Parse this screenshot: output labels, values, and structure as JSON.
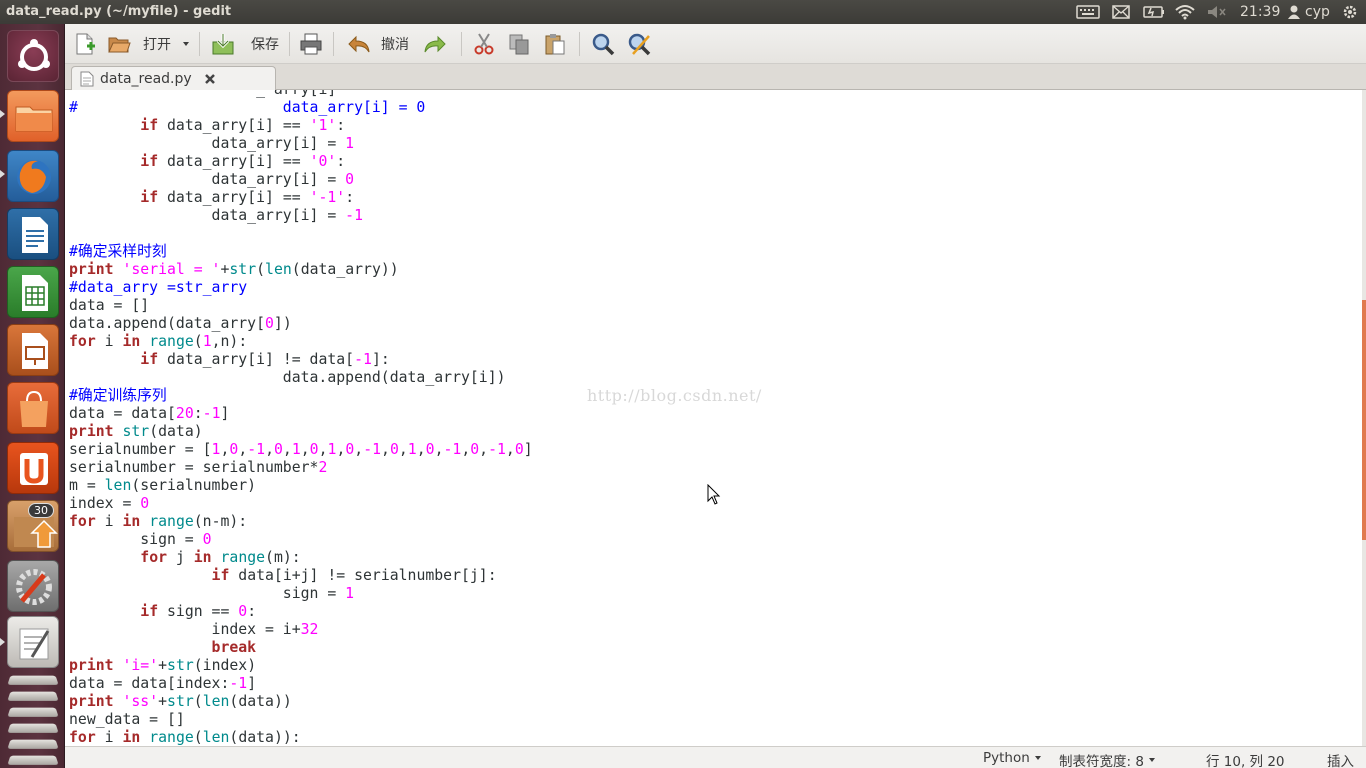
{
  "window": {
    "title": "data_read.py (~/myfile) - gedit"
  },
  "tray": {
    "time": "21:39",
    "user": "cyp"
  },
  "launcher": {
    "items": [
      {
        "name": "ubuntu-dash"
      },
      {
        "name": "files"
      },
      {
        "name": "firefox"
      },
      {
        "name": "libreoffice-writer"
      },
      {
        "name": "libreoffice-calc"
      },
      {
        "name": "libreoffice-impress"
      },
      {
        "name": "software-center"
      },
      {
        "name": "ubuntu-one"
      },
      {
        "name": "update-manager"
      },
      {
        "name": "system-settings"
      },
      {
        "name": "gedit"
      }
    ],
    "update_badge": "30"
  },
  "toolbar": {
    "open_label": "打开",
    "save_label": "保存",
    "undo_label": "撤消"
  },
  "tab": {
    "label": "data_read.py"
  },
  "editor": {
    "lines": [
      [
        {
          "t": "                     _ ",
          "c": ""
        },
        {
          "t": "arry[i]",
          "c": ""
        }
      ],
      [
        {
          "t": "#                       data_arry[i] = 0",
          "c": "com"
        }
      ],
      [
        {
          "t": "        ",
          "c": ""
        },
        {
          "t": "if",
          "c": "kw"
        },
        {
          "t": " data_arry[i] == ",
          "c": ""
        },
        {
          "t": "'1'",
          "c": "str"
        },
        {
          "t": ":",
          "c": ""
        }
      ],
      [
        {
          "t": "                data_arry[i] = ",
          "c": ""
        },
        {
          "t": "1",
          "c": "num"
        }
      ],
      [
        {
          "t": "        ",
          "c": ""
        },
        {
          "t": "if",
          "c": "kw"
        },
        {
          "t": " data_arry[i] == ",
          "c": ""
        },
        {
          "t": "'0'",
          "c": "str"
        },
        {
          "t": ":",
          "c": ""
        }
      ],
      [
        {
          "t": "                data_arry[i] = ",
          "c": ""
        },
        {
          "t": "0",
          "c": "num"
        }
      ],
      [
        {
          "t": "        ",
          "c": ""
        },
        {
          "t": "if",
          "c": "kw"
        },
        {
          "t": " data_arry[i] == ",
          "c": ""
        },
        {
          "t": "'-1'",
          "c": "str"
        },
        {
          "t": ":",
          "c": ""
        }
      ],
      [
        {
          "t": "                data_arry[i] = ",
          "c": ""
        },
        {
          "t": "-1",
          "c": "num"
        }
      ],
      [],
      [
        {
          "t": "#确定采样时刻",
          "c": "com"
        }
      ],
      [
        {
          "t": "print",
          "c": "kw"
        },
        {
          "t": " ",
          "c": ""
        },
        {
          "t": "'serial = '",
          "c": "str"
        },
        {
          "t": "+",
          "c": ""
        },
        {
          "t": "str",
          "c": "bi"
        },
        {
          "t": "(",
          "c": ""
        },
        {
          "t": "len",
          "c": "bi"
        },
        {
          "t": "(data_arry))",
          "c": ""
        }
      ],
      [
        {
          "t": "#data_arry =str_arry",
          "c": "com"
        }
      ],
      [
        {
          "t": "data = []",
          "c": ""
        }
      ],
      [
        {
          "t": "data.append(data_arry[",
          "c": ""
        },
        {
          "t": "0",
          "c": "num"
        },
        {
          "t": "])",
          "c": ""
        }
      ],
      [
        {
          "t": "for",
          "c": "kw"
        },
        {
          "t": " i ",
          "c": ""
        },
        {
          "t": "in",
          "c": "kw"
        },
        {
          "t": " ",
          "c": ""
        },
        {
          "t": "range",
          "c": "bi"
        },
        {
          "t": "(",
          "c": ""
        },
        {
          "t": "1",
          "c": "num"
        },
        {
          "t": ",n):",
          "c": ""
        }
      ],
      [
        {
          "t": "        ",
          "c": ""
        },
        {
          "t": "if",
          "c": "kw"
        },
        {
          "t": " data_arry[i] != data[",
          "c": ""
        },
        {
          "t": "-1",
          "c": "num"
        },
        {
          "t": "]:",
          "c": ""
        }
      ],
      [
        {
          "t": "                        data.append(data_arry[i])",
          "c": ""
        }
      ],
      [
        {
          "t": "#确定训练序列",
          "c": "com"
        }
      ],
      [
        {
          "t": "data = data[",
          "c": ""
        },
        {
          "t": "20",
          "c": "num"
        },
        {
          "t": ":",
          "c": ""
        },
        {
          "t": "-1",
          "c": "num"
        },
        {
          "t": "]",
          "c": ""
        }
      ],
      [
        {
          "t": "print",
          "c": "kw"
        },
        {
          "t": " ",
          "c": ""
        },
        {
          "t": "str",
          "c": "bi"
        },
        {
          "t": "(data)",
          "c": ""
        }
      ],
      [
        {
          "t": "serialnumber = [",
          "c": ""
        },
        {
          "t": "1",
          "c": "num"
        },
        {
          "t": ",",
          "c": ""
        },
        {
          "t": "0",
          "c": "num"
        },
        {
          "t": ",",
          "c": ""
        },
        {
          "t": "-1",
          "c": "num"
        },
        {
          "t": ",",
          "c": ""
        },
        {
          "t": "0",
          "c": "num"
        },
        {
          "t": ",",
          "c": ""
        },
        {
          "t": "1",
          "c": "num"
        },
        {
          "t": ",",
          "c": ""
        },
        {
          "t": "0",
          "c": "num"
        },
        {
          "t": ",",
          "c": ""
        },
        {
          "t": "1",
          "c": "num"
        },
        {
          "t": ",",
          "c": ""
        },
        {
          "t": "0",
          "c": "num"
        },
        {
          "t": ",",
          "c": ""
        },
        {
          "t": "-1",
          "c": "num"
        },
        {
          "t": ",",
          "c": ""
        },
        {
          "t": "0",
          "c": "num"
        },
        {
          "t": ",",
          "c": ""
        },
        {
          "t": "1",
          "c": "num"
        },
        {
          "t": ",",
          "c": ""
        },
        {
          "t": "0",
          "c": "num"
        },
        {
          "t": ",",
          "c": ""
        },
        {
          "t": "-1",
          "c": "num"
        },
        {
          "t": ",",
          "c": ""
        },
        {
          "t": "0",
          "c": "num"
        },
        {
          "t": ",",
          "c": ""
        },
        {
          "t": "-1",
          "c": "num"
        },
        {
          "t": ",",
          "c": ""
        },
        {
          "t": "0",
          "c": "num"
        },
        {
          "t": "]",
          "c": ""
        }
      ],
      [
        {
          "t": "serialnumber = serialnumber*",
          "c": ""
        },
        {
          "t": "2",
          "c": "num"
        }
      ],
      [
        {
          "t": "m = ",
          "c": ""
        },
        {
          "t": "len",
          "c": "bi"
        },
        {
          "t": "(serialnumber)",
          "c": ""
        }
      ],
      [
        {
          "t": "index = ",
          "c": ""
        },
        {
          "t": "0",
          "c": "num"
        }
      ],
      [
        {
          "t": "for",
          "c": "kw"
        },
        {
          "t": " i ",
          "c": ""
        },
        {
          "t": "in",
          "c": "kw"
        },
        {
          "t": " ",
          "c": ""
        },
        {
          "t": "range",
          "c": "bi"
        },
        {
          "t": "(n-m):",
          "c": ""
        }
      ],
      [
        {
          "t": "        sign = ",
          "c": ""
        },
        {
          "t": "0",
          "c": "num"
        }
      ],
      [
        {
          "t": "        ",
          "c": ""
        },
        {
          "t": "for",
          "c": "kw"
        },
        {
          "t": " j ",
          "c": ""
        },
        {
          "t": "in",
          "c": "kw"
        },
        {
          "t": " ",
          "c": ""
        },
        {
          "t": "range",
          "c": "bi"
        },
        {
          "t": "(m):",
          "c": ""
        }
      ],
      [
        {
          "t": "                ",
          "c": ""
        },
        {
          "t": "if",
          "c": "kw"
        },
        {
          "t": " data[i+j] != serialnumber[j]:",
          "c": ""
        }
      ],
      [
        {
          "t": "                        sign = ",
          "c": ""
        },
        {
          "t": "1",
          "c": "num"
        }
      ],
      [
        {
          "t": "        ",
          "c": ""
        },
        {
          "t": "if",
          "c": "kw"
        },
        {
          "t": " sign == ",
          "c": ""
        },
        {
          "t": "0",
          "c": "num"
        },
        {
          "t": ":",
          "c": ""
        }
      ],
      [
        {
          "t": "                index = i+",
          "c": ""
        },
        {
          "t": "32",
          "c": "num"
        }
      ],
      [
        {
          "t": "                ",
          "c": ""
        },
        {
          "t": "break",
          "c": "kw"
        }
      ],
      [
        {
          "t": "print",
          "c": "kw"
        },
        {
          "t": " ",
          "c": ""
        },
        {
          "t": "'i='",
          "c": "str"
        },
        {
          "t": "+",
          "c": ""
        },
        {
          "t": "str",
          "c": "bi"
        },
        {
          "t": "(index)",
          "c": ""
        }
      ],
      [
        {
          "t": "data = data[index:",
          "c": ""
        },
        {
          "t": "-1",
          "c": "num"
        },
        {
          "t": "]",
          "c": ""
        }
      ],
      [
        {
          "t": "print",
          "c": "kw"
        },
        {
          "t": " ",
          "c": ""
        },
        {
          "t": "'ss'",
          "c": "str"
        },
        {
          "t": "+",
          "c": ""
        },
        {
          "t": "str",
          "c": "bi"
        },
        {
          "t": "(",
          "c": ""
        },
        {
          "t": "len",
          "c": "bi"
        },
        {
          "t": "(data))",
          "c": ""
        }
      ],
      [
        {
          "t": "new_data = []",
          "c": ""
        }
      ],
      [
        {
          "t": "for",
          "c": "kw"
        },
        {
          "t": " i ",
          "c": ""
        },
        {
          "t": "in",
          "c": "kw"
        },
        {
          "t": " ",
          "c": ""
        },
        {
          "t": "range",
          "c": "bi"
        },
        {
          "t": "(",
          "c": ""
        },
        {
          "t": "len",
          "c": "bi"
        },
        {
          "t": "(data)):",
          "c": ""
        }
      ]
    ],
    "watermark": "http://blog.csdn.net/"
  },
  "statusbar": {
    "language": "Python",
    "tab_width": "制表符宽度: 8",
    "position": "行 10, 列 20",
    "mode": "插入"
  },
  "colors": {
    "keyword": "#a52a2a",
    "string": "#ff00ff",
    "comment": "#0000ff",
    "builtin": "#008a8c",
    "scroll_thumb": "#e07a4f"
  }
}
